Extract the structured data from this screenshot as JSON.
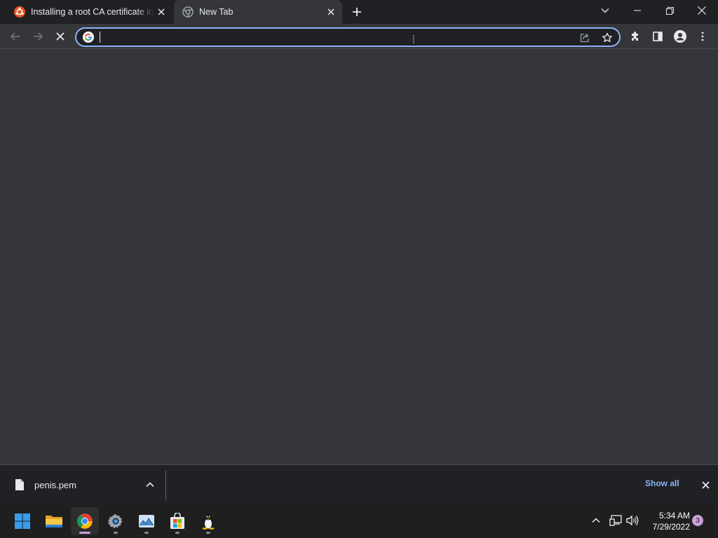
{
  "tabs": [
    {
      "title": "Installing a root CA certificate in the trust store",
      "favicon": "ubuntu-icon",
      "active": false
    },
    {
      "title": "New Tab",
      "favicon": "chrome-newtab-icon",
      "active": true
    }
  ],
  "omnibox": {
    "value": "",
    "placeholder": ""
  },
  "download": {
    "filename": "penis.pem",
    "show_all_label": "Show all"
  },
  "taskbar": {
    "apps": [
      "windows-start-icon",
      "file-explorer-icon",
      "chrome-icon",
      "settings-icon",
      "photos-icon",
      "microsoft-store-icon",
      "linux-penguin-icon"
    ],
    "time": "5:34 AM",
    "date": "7/29/2022",
    "notification_count": "3"
  },
  "colors": {
    "accent": "#8ab4f8",
    "tabstrip_bg": "#202124",
    "toolbar_bg": "#35363a",
    "taskbar_bg": "#1f1f1f"
  }
}
